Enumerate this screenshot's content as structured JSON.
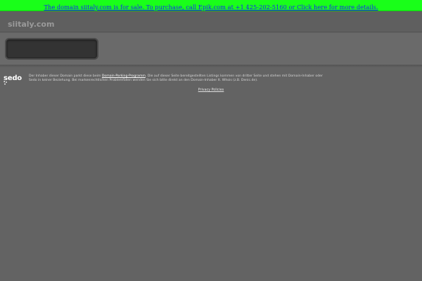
{
  "banner": {
    "text": "The domain siitaly.com is for sale. To purchase, call Epik.com at +1 425-202-5160 or Click here for more details."
  },
  "header": {
    "title": "siitaly.com"
  },
  "search": {
    "value": "",
    "placeholder": ""
  },
  "footer": {
    "logo_text": "sedo",
    "disclaimer_before_link": "Der Inhaber dieser Domain parkt diese beim ",
    "disclaimer_link": "Domain-Parking-Programm",
    "disclaimer_after_link": ". Die auf dieser Seite bereitgestellten Listings kommen von dritter Seite und stehen mit Domain-Inhaber oder Sedo in keiner Beziehung. Bei markenrechtlichen Problemfällen wenden Sie sich bitte direkt an den Domain-Inhaber lt. Whois (z.B. Denic.de).",
    "privacy_label": "Privacy Policies"
  },
  "colors": {
    "banner_bg": "#19ff19",
    "banner_link": "#1a1aff",
    "page_bg": "#636363",
    "search_bg": "#333333"
  },
  "icons": {
    "logo": "sedo-logo-icon"
  }
}
